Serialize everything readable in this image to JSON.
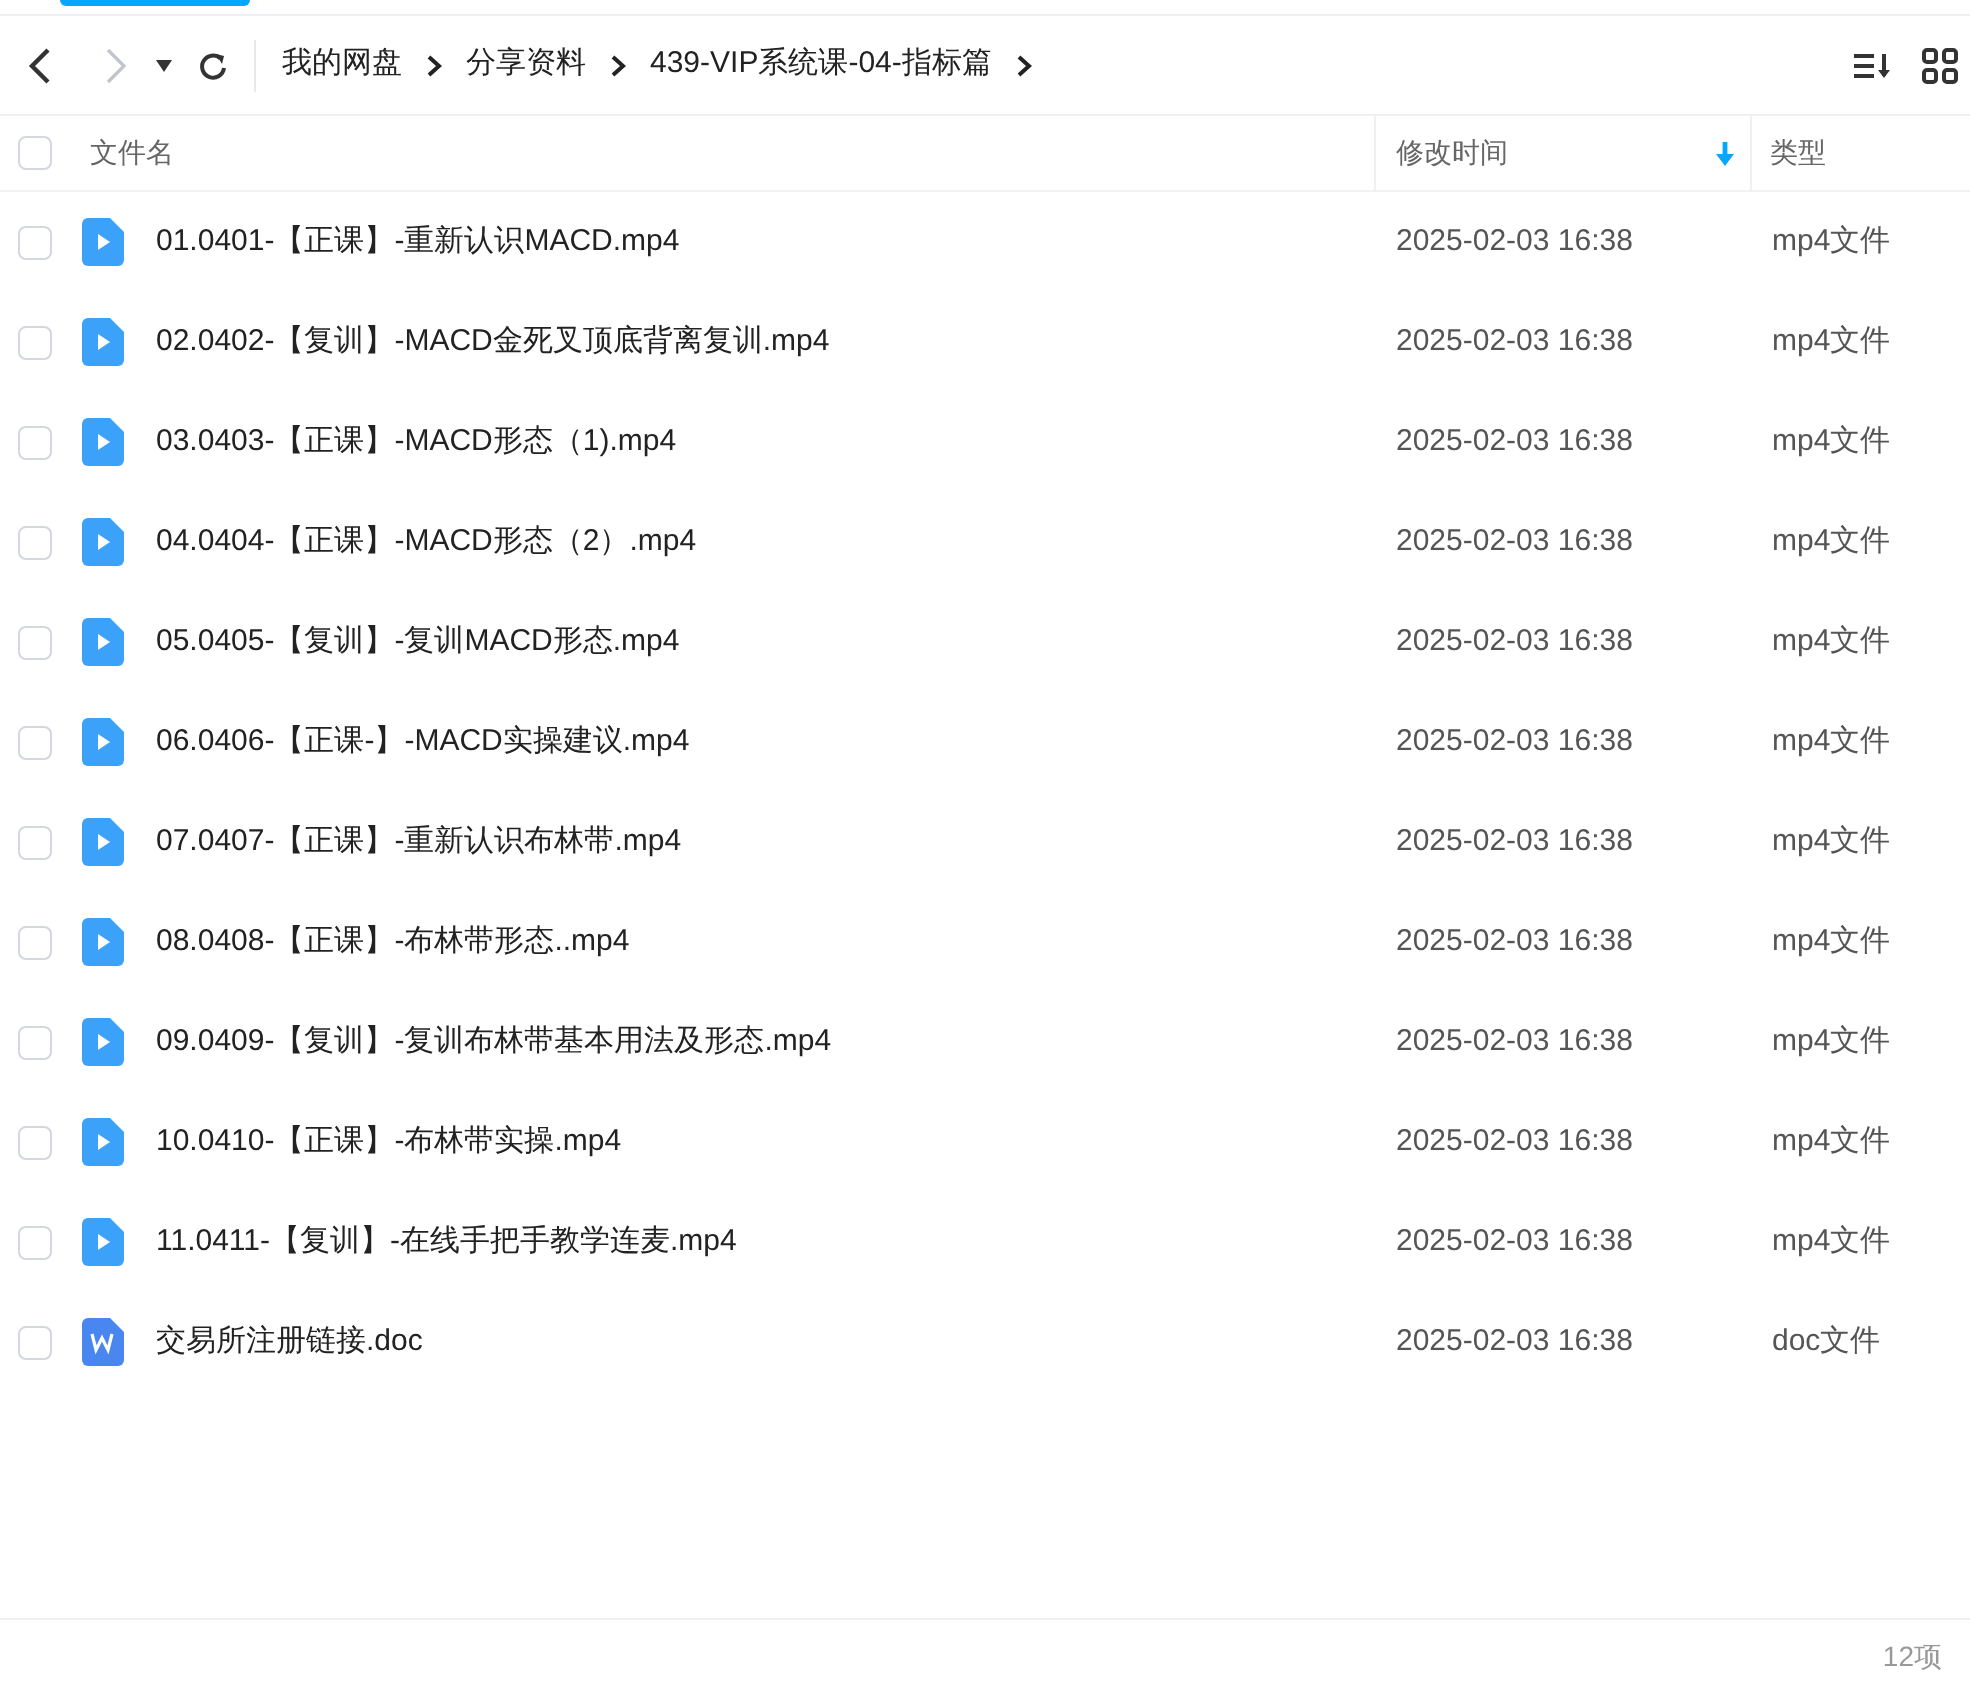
{
  "breadcrumb": [
    "我的网盘",
    "分享资料",
    "439-VIP系统课-04-指标篇"
  ],
  "nav": {
    "back_disabled": false,
    "forward_disabled": true
  },
  "table": {
    "all_checked": false,
    "columns": [
      {
        "label": "文件名",
        "sorted": false
      },
      {
        "label": "修改时间",
        "sorted": true
      },
      {
        "label": "类型",
        "sorted": false
      }
    ],
    "rows": [
      {
        "kind": "video",
        "name": "01.0401-【正课】-重新认识MACD.mp4",
        "time": "2025-02-03 16:38",
        "type": "mp4文件",
        "checked": false
      },
      {
        "kind": "video",
        "name": "02.0402-【复训】-MACD金死叉顶底背离复训.mp4",
        "time": "2025-02-03 16:38",
        "type": "mp4文件",
        "checked": false
      },
      {
        "kind": "video",
        "name": "03.0403-【正课】-MACD形态（1).mp4",
        "time": "2025-02-03 16:38",
        "type": "mp4文件",
        "checked": false
      },
      {
        "kind": "video",
        "name": "04.0404-【正课】-MACD形态（2）.mp4",
        "time": "2025-02-03 16:38",
        "type": "mp4文件",
        "checked": false
      },
      {
        "kind": "video",
        "name": "05.0405-【复训】-复训MACD形态.mp4",
        "time": "2025-02-03 16:38",
        "type": "mp4文件",
        "checked": false
      },
      {
        "kind": "video",
        "name": "06.0406-【正课-】-MACD实操建议.mp4",
        "time": "2025-02-03 16:38",
        "type": "mp4文件",
        "checked": false
      },
      {
        "kind": "video",
        "name": "07.0407-【正课】-重新认识布林带.mp4",
        "time": "2025-02-03 16:38",
        "type": "mp4文件",
        "checked": false
      },
      {
        "kind": "video",
        "name": "08.0408-【正课】-布林带形态..mp4",
        "time": "2025-02-03 16:38",
        "type": "mp4文件",
        "checked": false
      },
      {
        "kind": "video",
        "name": "09.0409-【复训】-复训布林带基本用法及形态.mp4",
        "time": "2025-02-03 16:38",
        "type": "mp4文件",
        "checked": false
      },
      {
        "kind": "video",
        "name": "10.0410-【正课】-布林带实操.mp4",
        "time": "2025-02-03 16:38",
        "type": "mp4文件",
        "checked": false
      },
      {
        "kind": "video",
        "name": "11.0411-【复训】-在线手把手教学连麦.mp4",
        "time": "2025-02-03 16:38",
        "type": "mp4文件",
        "checked": false
      },
      {
        "kind": "doc",
        "name": "交易所注册链接.doc",
        "time": "2025-02-03 16:38",
        "type": "doc文件",
        "checked": false
      }
    ]
  },
  "status_bar": {
    "count": "12项"
  }
}
